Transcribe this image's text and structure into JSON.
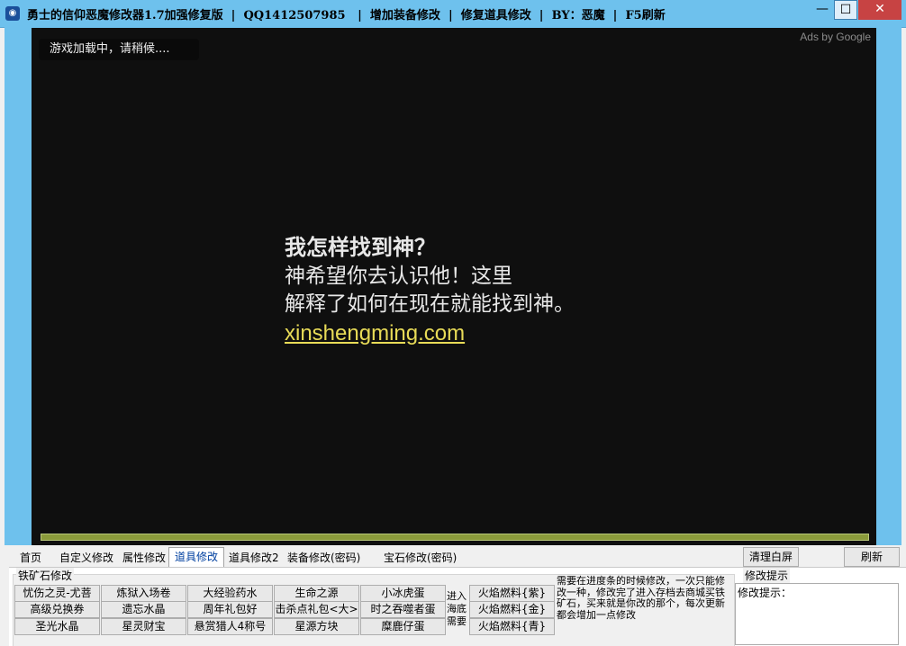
{
  "window": {
    "title": "勇士的信仰恶魔修改器1.7加强修复版  |  QQ1412507985   |  增加装备修改  |  修复道具修改  |  BY：恶魔  |  F5刷新",
    "min_glyph": "—",
    "max_glyph": "☐",
    "close_glyph": "✕"
  },
  "game": {
    "loading_text": "游戏加载中，请稍候....",
    "ads_label": "Ads by Google",
    "ad_title": "我怎样找到神？",
    "ad_line1": "神希望你去认识他！这里",
    "ad_line2": "解释了如何在现在就能找到神。",
    "ad_link": "xinshengming.com",
    "progress": 1.0
  },
  "tabs": [
    "首页",
    "自定义修改",
    "属性修改",
    "道具修改",
    "道具修改2",
    "装备修改(密码)",
    "宝石修改(密码)"
  ],
  "active_tab": "道具修改",
  "toolbar": {
    "clear_label": "清理白屏",
    "refresh_label": "刷新"
  },
  "group": {
    "title": "铁矿石修改",
    "items": [
      [
        "忧伤之灵-尤菩",
        "炼狱入场卷",
        "大经验药水",
        "生命之源",
        "小冰虎蛋"
      ],
      [
        "高级兑换券",
        "遗忘水晶",
        "周年礼包好",
        "击杀点礼包<大>",
        "时之吞噬者蛋"
      ],
      [
        "圣光水晶",
        "星灵财宝",
        "悬赏猎人4称号",
        "星源方块",
        "糜鹿仔蛋"
      ]
    ],
    "side_label": "进入海底需要",
    "fuel": [
      "火焰燃料{紫}",
      "火焰燃料{金}",
      "火焰燃料{青}"
    ],
    "note": "需要在进度条的时候修改，一次只能修改一种，修改完了进入存档去商城买铁矿石，买来就是你改的那个，每次更新都会增加一点修改"
  },
  "hint": {
    "title": "修改提示",
    "content": "修改提示："
  }
}
